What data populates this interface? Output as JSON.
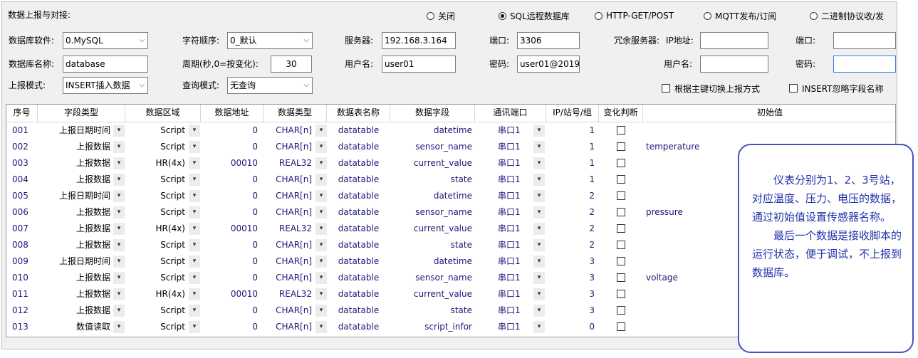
{
  "panel": {
    "title": "数据上报与对接:"
  },
  "mode_options": [
    {
      "label": "关闭",
      "selected": false
    },
    {
      "label": "SQL远程数据库",
      "selected": true
    },
    {
      "label": "HTTP-GET/POST",
      "selected": false
    },
    {
      "label": "MQTT发布/订阅",
      "selected": false
    },
    {
      "label": "二进制协议收/发",
      "selected": false
    }
  ],
  "form": {
    "db_software_label": "数据库软件:",
    "db_software_value": "0.MySQL",
    "byte_order_label": "字符顺序:",
    "byte_order_value": "0_默认",
    "server_label": "服务器:",
    "server_value": "192.168.3.164",
    "port_label": "端口:",
    "port_value": "3306",
    "redundant_label": "冗余服务器:",
    "redundant_ip_label": "IP地址:",
    "redundant_ip_value": "",
    "redundant_port_label": "端口:",
    "redundant_port_value": "",
    "db_name_label": "数据库名称:",
    "db_name_value": "database",
    "period_label": "周期(秒,0=按变化):",
    "period_value": "30",
    "user_label": "用户名:",
    "user_value": "user01",
    "password_label": "密码:",
    "password_value": "user01@2019(",
    "redundant_user_label": "用户名:",
    "redundant_user_value": "",
    "redundant_password_label": "密码:",
    "redundant_password_value": "",
    "report_mode_label": "上报模式:",
    "report_mode_value": "INSERT插入数据",
    "query_mode_label": "查询模式:",
    "query_mode_value": "无查询",
    "switch_by_key_label": "根据主键切换上报方式",
    "ignore_field_name_label": "INSERT忽略字段名称"
  },
  "table": {
    "headers": [
      "序号",
      "字段类型",
      "数据区域",
      "数据地址",
      "数据类型",
      "数据表名称",
      "数据字段",
      "通讯端口",
      "IP/站号/组",
      "变化判断",
      "初始值"
    ],
    "rows": [
      {
        "no": "001",
        "field_type": "上报日期时间",
        "area": "Script",
        "addr": "0",
        "dtype": "CHAR[n]",
        "table": "datatable",
        "field": "datetime",
        "port": "串口1",
        "station": "1",
        "init": ""
      },
      {
        "no": "002",
        "field_type": "上报数据",
        "area": "Script",
        "addr": "0",
        "dtype": "CHAR[n]",
        "table": "datatable",
        "field": "sensor_name",
        "port": "串口1",
        "station": "1",
        "init": "temperature"
      },
      {
        "no": "003",
        "field_type": "上报数据",
        "area": "HR(4x)",
        "addr": "00010",
        "dtype": "REAL32",
        "table": "datatable",
        "field": "current_value",
        "port": "串口1",
        "station": "1",
        "init": ""
      },
      {
        "no": "004",
        "field_type": "上报数据",
        "area": "Script",
        "addr": "0",
        "dtype": "CHAR[n]",
        "table": "datatable",
        "field": "state",
        "port": "串口1",
        "station": "1",
        "init": ""
      },
      {
        "no": "005",
        "field_type": "上报日期时间",
        "area": "Script",
        "addr": "0",
        "dtype": "CHAR[n]",
        "table": "datatable",
        "field": "datetime",
        "port": "串口1",
        "station": "2",
        "init": ""
      },
      {
        "no": "006",
        "field_type": "上报数据",
        "area": "Script",
        "addr": "0",
        "dtype": "CHAR[n]",
        "table": "datatable",
        "field": "sensor_name",
        "port": "串口1",
        "station": "2",
        "init": "pressure"
      },
      {
        "no": "007",
        "field_type": "上报数据",
        "area": "HR(4x)",
        "addr": "00010",
        "dtype": "REAL32",
        "table": "datatable",
        "field": "current_value",
        "port": "串口1",
        "station": "2",
        "init": ""
      },
      {
        "no": "008",
        "field_type": "上报数据",
        "area": "Script",
        "addr": "0",
        "dtype": "CHAR[n]",
        "table": "datatable",
        "field": "state",
        "port": "串口1",
        "station": "2",
        "init": ""
      },
      {
        "no": "009",
        "field_type": "上报日期时间",
        "area": "Script",
        "addr": "0",
        "dtype": "CHAR[n]",
        "table": "datatable",
        "field": "datetime",
        "port": "串口1",
        "station": "3",
        "init": ""
      },
      {
        "no": "010",
        "field_type": "上报数据",
        "area": "Script",
        "addr": "0",
        "dtype": "CHAR[n]",
        "table": "datatable",
        "field": "sensor_name",
        "port": "串口1",
        "station": "3",
        "init": "voltage"
      },
      {
        "no": "011",
        "field_type": "上报数据",
        "area": "HR(4x)",
        "addr": "00010",
        "dtype": "REAL32",
        "table": "datatable",
        "field": "current_value",
        "port": "串口1",
        "station": "3",
        "init": ""
      },
      {
        "no": "012",
        "field_type": "上报数据",
        "area": "Script",
        "addr": "0",
        "dtype": "CHAR[n]",
        "table": "datatable",
        "field": "state",
        "port": "串口1",
        "station": "3",
        "init": ""
      },
      {
        "no": "013",
        "field_type": "数值读取",
        "area": "Script",
        "addr": "0",
        "dtype": "CHAR[n]",
        "table": "datatable",
        "field": "script_infor",
        "port": "串口1",
        "station": "0",
        "init": ""
      }
    ]
  },
  "callout": {
    "para1": "仪表分别为1、2、3号站，对应温度、压力、电压的数据，通过初始值设置传感器名称。",
    "para2": "最后一个数据是接收脚本的运行状态，便于调试，不上报到数据库。"
  }
}
